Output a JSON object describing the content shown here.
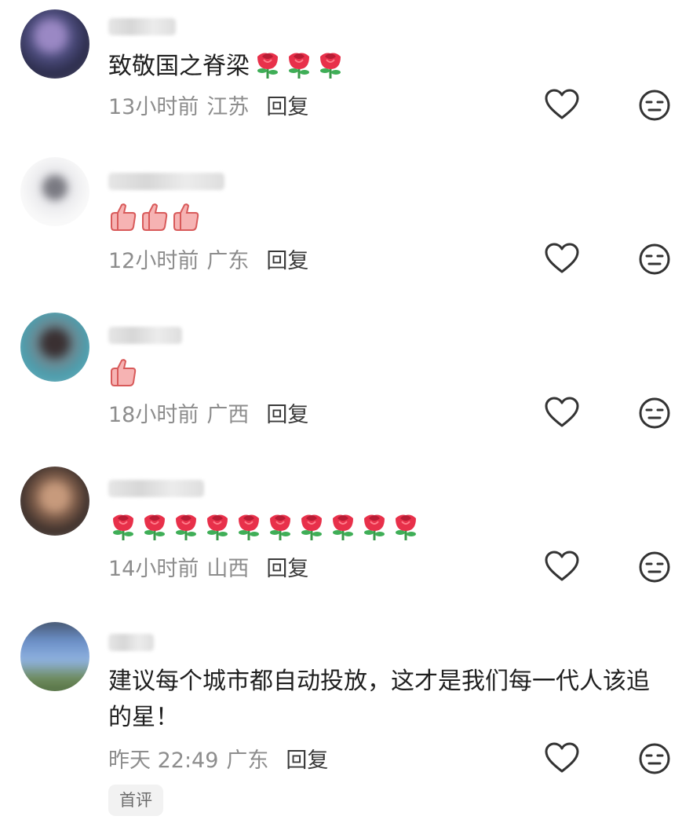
{
  "comments": [
    {
      "content": "致敬国之脊梁",
      "emojis": [
        "rose",
        "rose",
        "rose"
      ],
      "time": "13小时前",
      "location": "江苏",
      "reply": "回复"
    },
    {
      "content": "",
      "emojis": [
        "thumbs-up",
        "thumbs-up",
        "thumbs-up"
      ],
      "time": "12小时前",
      "location": "广东",
      "reply": "回复"
    },
    {
      "content": "",
      "emojis": [
        "thumbs-up"
      ],
      "time": "18小时前",
      "location": "广西",
      "reply": "回复"
    },
    {
      "content": "",
      "emojis": [
        "rose",
        "rose",
        "rose",
        "rose",
        "rose",
        "rose",
        "rose",
        "rose",
        "rose",
        "rose"
      ],
      "time": "14小时前",
      "location": "山西",
      "reply": "回复"
    },
    {
      "content": "建议每个城市都自动投放，这才是我们每一代人该追的星！",
      "emojis": [],
      "time": "昨天 22:49",
      "location": "广东",
      "reply": "回复",
      "badge": "首评"
    }
  ],
  "icons": {
    "like": "heart-outline-icon",
    "dislike": "neutral-face-icon"
  },
  "colors": {
    "text": "#1f1f1f",
    "meta": "#8d8d8d",
    "rose": "#e8304a",
    "thumb": "#f4a4a4"
  }
}
